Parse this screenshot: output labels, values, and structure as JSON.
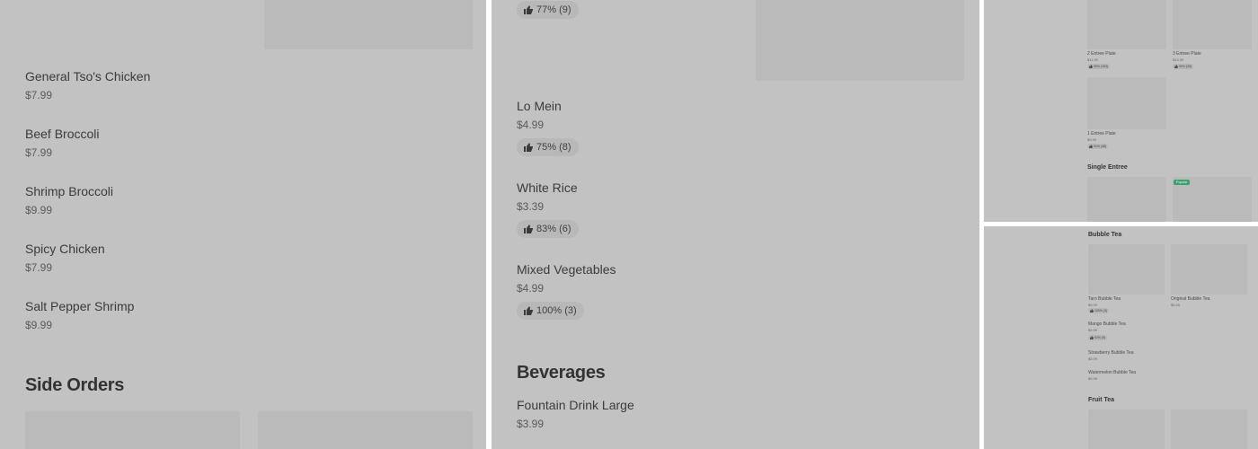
{
  "panel1": {
    "entrees": [
      {
        "name": "General Tso's Chicken",
        "price": "$7.99"
      },
      {
        "name": "Beef Broccoli",
        "price": "$7.99"
      },
      {
        "name": "Shrimp Broccoli",
        "price": "$9.99"
      },
      {
        "name": "Spicy Chicken",
        "price": "$7.99"
      },
      {
        "name": "Salt Pepper Shrimp",
        "price": "$9.99"
      }
    ],
    "side_orders_title": "Side Orders"
  },
  "panel2": {
    "top_rating": "77% (9)",
    "items": [
      {
        "name": "Lo Mein",
        "price": "$4.99",
        "rating": "75% (8)"
      },
      {
        "name": "White Rice",
        "price": "$3.39",
        "rating": "83% (6)"
      },
      {
        "name": "Mixed Vegetables",
        "price": "$4.99",
        "rating": "100% (3)"
      }
    ],
    "beverages_title": "Beverages",
    "beverage": {
      "name": "Fountain Drink Large",
      "price": "$3.99"
    }
  },
  "panel3": {
    "plates": [
      {
        "name": "2 Entree Plate",
        "price": "$11.99",
        "rating": "90% (103)"
      },
      {
        "name": "3 Entree Plate",
        "price": "$13.99",
        "rating": "90% (93)"
      },
      {
        "name": "1 Entree Plate",
        "price": "$9.99",
        "rating": "91% (48)"
      }
    ],
    "single_entree_title": "Single Entree",
    "popular_badge": "Popular"
  },
  "panel4": {
    "bubble_tea_title": "Bubble Tea",
    "teas": [
      {
        "name": "Taro Bubble Tea",
        "price": "$5.99",
        "rating": "100% (3)"
      },
      {
        "name": "Original Bubble Tea",
        "price": "$5.99"
      },
      {
        "name": "Mango Bubble Tea",
        "price": "$5.99",
        "rating": "92% (9)"
      },
      {
        "name": "Strawberry Bubble Tea",
        "price": "$5.99"
      },
      {
        "name": "Watermelon Bubble Tea",
        "price": "$5.99"
      }
    ],
    "fruit_tea_title": "Fruit Tea"
  },
  "icons": {
    "rating": "thumbs-up-icon"
  },
  "colors": {
    "background": "#c2c2c2",
    "placeholder": "#bababa",
    "popular_badge": "#3aa171"
  }
}
